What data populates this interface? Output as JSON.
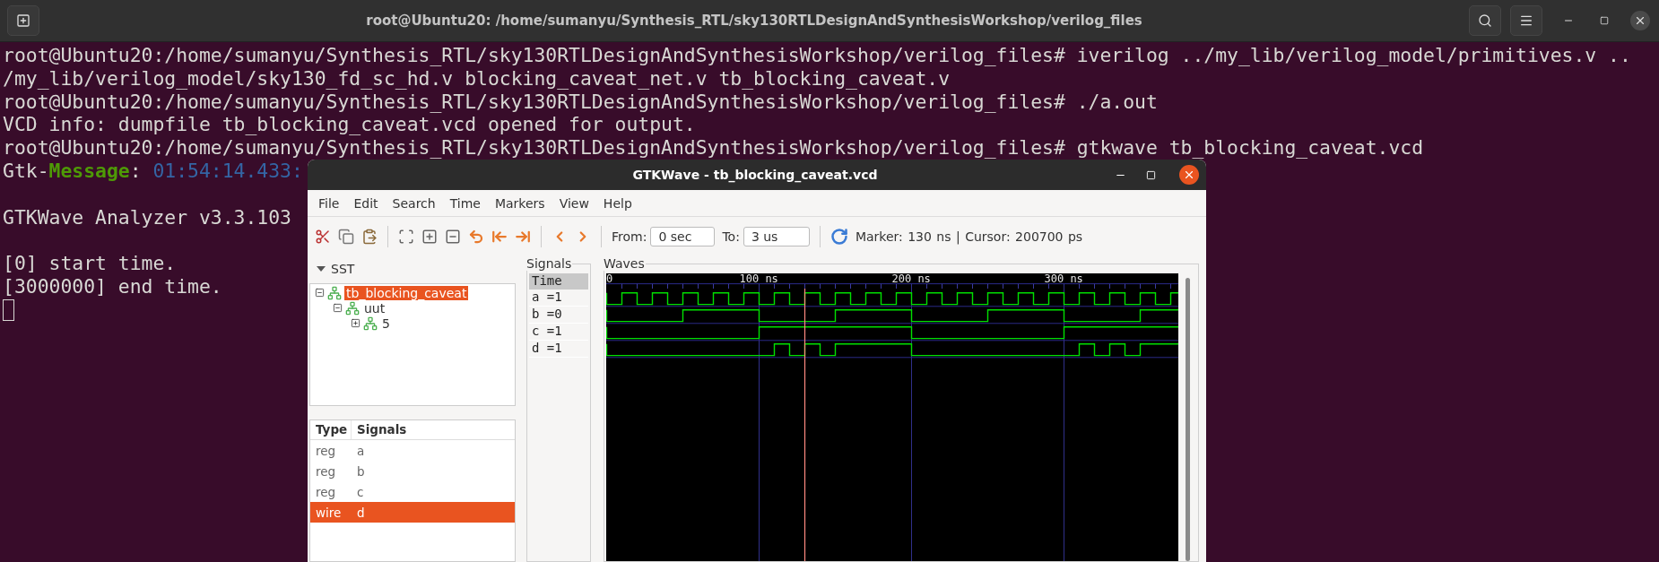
{
  "terminal": {
    "title": "root@Ubuntu20: /home/sumanyu/Synthesis_RTL/sky130RTLDesignAndSynthesisWorkshop/verilog_files",
    "lines": [
      {
        "kind": "text",
        "segments": [
          {
            "kind": "plain",
            "text": "root@Ubuntu20:/home/sumanyu/Synthesis_RTL/sky130RTLDesignAndSynthesisWorkshop/verilog_files# iverilog ../my_lib/verilog_model/primitives.v .."
          }
        ]
      },
      {
        "kind": "text",
        "segments": [
          {
            "kind": "plain",
            "text": "/my_lib/verilog_model/sky130_fd_sc_hd.v blocking_caveat_net.v tb_blocking_caveat.v"
          }
        ]
      },
      {
        "kind": "text",
        "segments": [
          {
            "kind": "plain",
            "text": "root@Ubuntu20:/home/sumanyu/Synthesis_RTL/sky130RTLDesignAndSynthesisWorkshop/verilog_files# ./a.out"
          }
        ]
      },
      {
        "kind": "text",
        "segments": [
          {
            "kind": "plain",
            "text": "VCD info: dumpfile tb_blocking_caveat.vcd opened for output."
          }
        ]
      },
      {
        "kind": "text",
        "segments": [
          {
            "kind": "plain",
            "text": "root@Ubuntu20:/home/sumanyu/Synthesis_RTL/sky130RTLDesignAndSynthesisWorkshop/verilog_files# gtkwave tb_blocking_caveat.vcd"
          }
        ]
      },
      {
        "kind": "text",
        "segments": [
          {
            "kind": "plain",
            "text": "Gtk-"
          },
          {
            "kind": "label",
            "text": "Message"
          },
          {
            "kind": "plain",
            "text": ": "
          },
          {
            "kind": "time",
            "text": "01:54:14.433:"
          }
        ]
      },
      {
        "kind": "blank"
      },
      {
        "kind": "text",
        "segments": [
          {
            "kind": "plain",
            "text": "GTKWave Analyzer v3.3.103"
          }
        ]
      },
      {
        "kind": "blank"
      },
      {
        "kind": "text",
        "segments": [
          {
            "kind": "plain",
            "text": "[0] start time."
          }
        ]
      },
      {
        "kind": "text",
        "segments": [
          {
            "kind": "plain",
            "text": "[3000000] end time."
          }
        ]
      },
      {
        "kind": "cursor"
      }
    ]
  },
  "gtkwave": {
    "title": "GTKWave - tb_blocking_caveat.vcd",
    "menu": [
      "File",
      "Edit",
      "Search",
      "Time",
      "Markers",
      "View",
      "Help"
    ],
    "from_label": "From:",
    "from_value": "0 sec",
    "to_label": "To:",
    "to_value": "3 us",
    "status": "Marker: 130 ns | Cursor: 200700 ps",
    "sst": {
      "title": "SST",
      "expanded": true,
      "tree": [
        {
          "label": "tb_blocking_caveat",
          "expanded": true,
          "selected": true,
          "children": [
            {
              "label": "uut",
              "expanded": true,
              "selected": false,
              "children": [
                {
                  "label": "5",
                  "expanded": false,
                  "selected": false
                }
              ]
            }
          ]
        }
      ],
      "columns": [
        "Type",
        "Signals"
      ],
      "rows": [
        {
          "type": "reg",
          "name": "a",
          "selected": false
        },
        {
          "type": "reg",
          "name": "b",
          "selected": false
        },
        {
          "type": "reg",
          "name": "c",
          "selected": false
        },
        {
          "type": "wire",
          "name": "d",
          "selected": true
        }
      ]
    },
    "signals": {
      "title": "Signals",
      "header": "Time",
      "rows": [
        "a =1",
        "b =0",
        "c =1",
        "d =1"
      ]
    },
    "waves": {
      "title": "Waves",
      "time_labels": [
        "0",
        "100 ns",
        "200 ns",
        "300 ns"
      ]
    }
  }
}
